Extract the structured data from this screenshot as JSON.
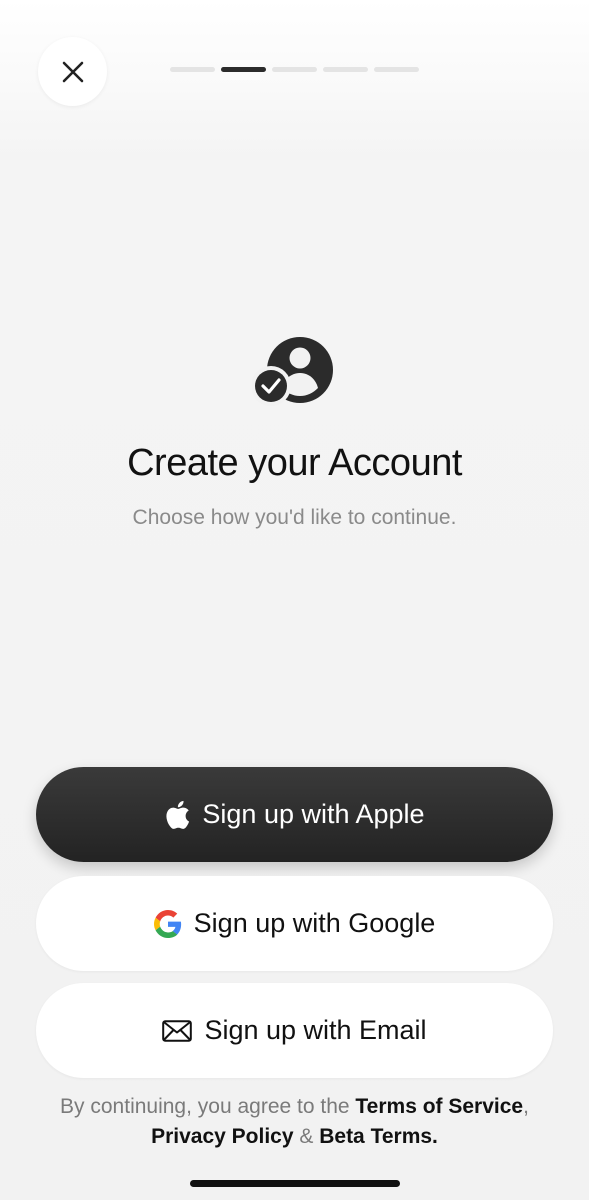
{
  "header": {
    "close_icon": "close-icon",
    "progress": {
      "total_steps": 5,
      "current_step": 2
    }
  },
  "hero": {
    "icon": "user-check-icon",
    "title": "Create your Account",
    "subtitle": "Choose how you'd like to continue."
  },
  "buttons": {
    "apple": {
      "label": "Sign up with Apple",
      "icon": "apple-icon"
    },
    "google": {
      "label": "Sign up with Google",
      "icon": "google-icon"
    },
    "email": {
      "label": "Sign up with Email",
      "icon": "mail-icon"
    }
  },
  "legal": {
    "prefix": "By continuing, you agree to the ",
    "terms": "Terms of Service",
    "comma": ", ",
    "privacy": "Privacy Policy",
    "amp": " & ",
    "beta": "Beta Terms."
  },
  "colors": {
    "primary_button": "#2b2b2b",
    "background": "#f2f2f2"
  }
}
